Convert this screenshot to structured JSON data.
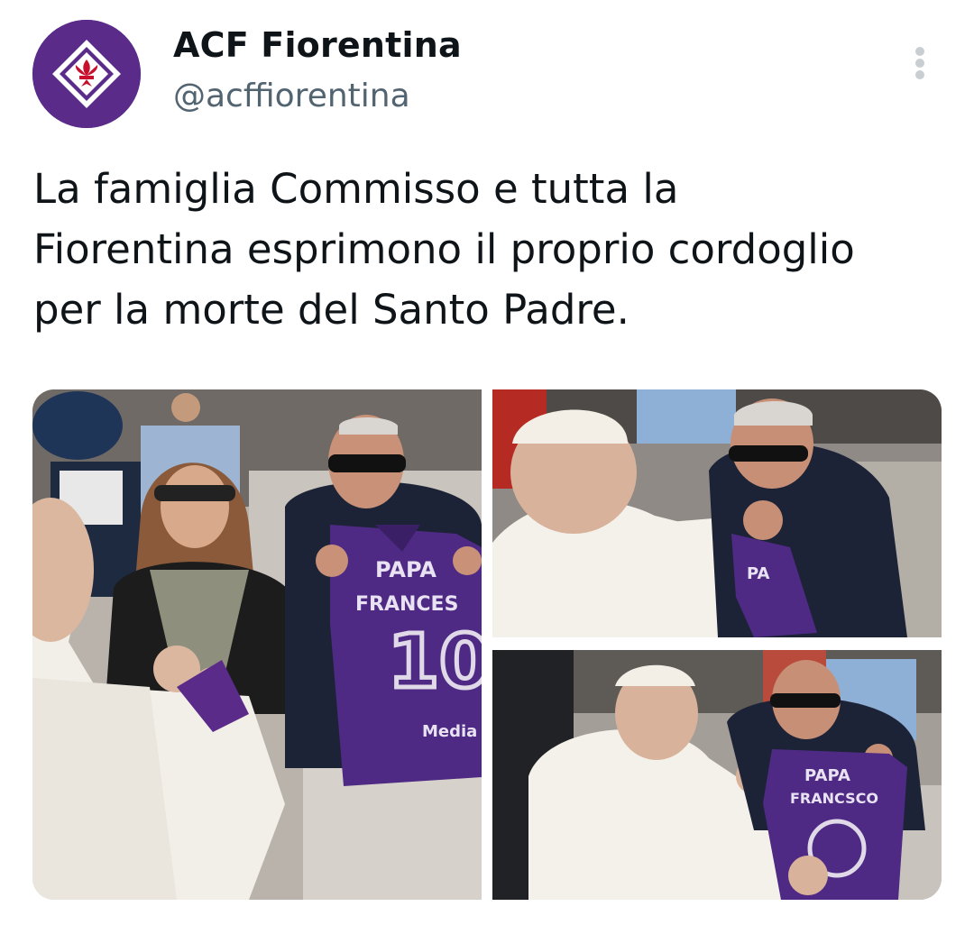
{
  "account": {
    "display_name": "ACF Fiorentina",
    "handle": "@acffiorentina",
    "avatar_icon": "fiorentina-lily-crest-icon",
    "brand_color": "#5b2b8a"
  },
  "menu": {
    "icon": "more-vertical-icon"
  },
  "tweet": {
    "text": "La famiglia Commisso e tutta la\nFiorentina esprimono il proprio cordoglio\nper la morte del Santo Padre."
  },
  "media": {
    "photos": [
      {
        "jersey_line1": "PAPA",
        "jersey_line2": "FRANCES",
        "jersey_number": "10",
        "jersey_sponsor": "Media"
      },
      {
        "jersey_fragment": "PA"
      },
      {
        "jersey_line1": "PAPA",
        "jersey_line2": "FRANCSCO"
      }
    ],
    "jersey_color": "#4e2a84"
  }
}
